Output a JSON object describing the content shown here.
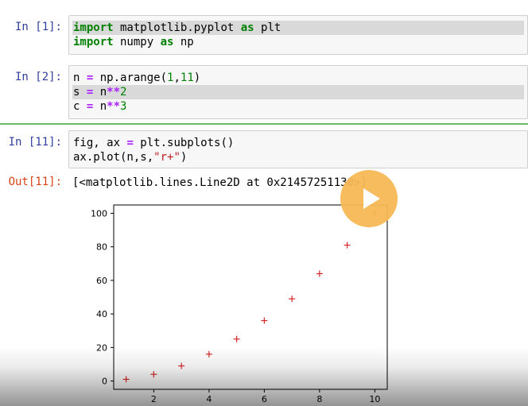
{
  "cells": [
    {
      "prompt": "In [1]:",
      "lines": [
        [
          {
            "t": "import",
            "c": "kw"
          },
          {
            "t": " matplotlib.pyplot ",
            "c": ""
          },
          {
            "t": "as",
            "c": "kw"
          },
          {
            "t": " plt",
            "c": ""
          }
        ],
        [
          {
            "t": "import",
            "c": "kw"
          },
          {
            "t": " numpy ",
            "c": ""
          },
          {
            "t": "as",
            "c": "kw"
          },
          {
            "t": " np",
            "c": ""
          }
        ]
      ]
    },
    {
      "prompt": "In [2]:",
      "lines": [
        [
          {
            "t": "n ",
            "c": ""
          },
          {
            "t": "=",
            "c": "op"
          },
          {
            "t": " np.arange(",
            "c": ""
          },
          {
            "t": "1",
            "c": "num"
          },
          {
            "t": ",",
            "c": ""
          },
          {
            "t": "11",
            "c": "num"
          },
          {
            "t": ")",
            "c": ""
          }
        ],
        [
          {
            "t": "s ",
            "c": ""
          },
          {
            "t": "=",
            "c": "op"
          },
          {
            "t": " n",
            "c": ""
          },
          {
            "t": "**",
            "c": "op"
          },
          {
            "t": "2",
            "c": "num"
          }
        ],
        [
          {
            "t": "c ",
            "c": ""
          },
          {
            "t": "=",
            "c": "op"
          },
          {
            "t": " n",
            "c": ""
          },
          {
            "t": "**",
            "c": "op"
          },
          {
            "t": "3",
            "c": "num"
          }
        ]
      ]
    },
    {
      "prompt": "In [11]:",
      "lines": [
        [
          {
            "t": "fig, ax ",
            "c": ""
          },
          {
            "t": "=",
            "c": "op"
          },
          {
            "t": " plt.subplots()",
            "c": ""
          }
        ],
        [
          {
            "t": "ax.plot(n,s,",
            "c": ""
          },
          {
            "t": "\"r+\"",
            "c": "str"
          },
          {
            "t": ")",
            "c": ""
          }
        ]
      ]
    }
  ],
  "output": {
    "prompt": "Out[11]:",
    "text": "[<matplotlib.lines.Line2D at 0x21457251130>]"
  },
  "chart_data": {
    "type": "scatter",
    "marker": "+",
    "color": "#d62728",
    "x": [
      1,
      2,
      3,
      4,
      5,
      6,
      7,
      8,
      9,
      10
    ],
    "y": [
      1,
      4,
      9,
      16,
      25,
      36,
      49,
      64,
      81,
      100
    ],
    "xticks": [
      "2",
      "4",
      "6",
      "8",
      "10"
    ],
    "yticks": [
      "0",
      "20",
      "40",
      "60",
      "80",
      "100"
    ],
    "xlim": [
      0.55,
      10.45
    ],
    "ylim": [
      -4.95,
      104.95
    ],
    "grid": false
  },
  "video_overlay": {
    "play_icon": "play-icon",
    "accent_color": "#f7b955"
  }
}
